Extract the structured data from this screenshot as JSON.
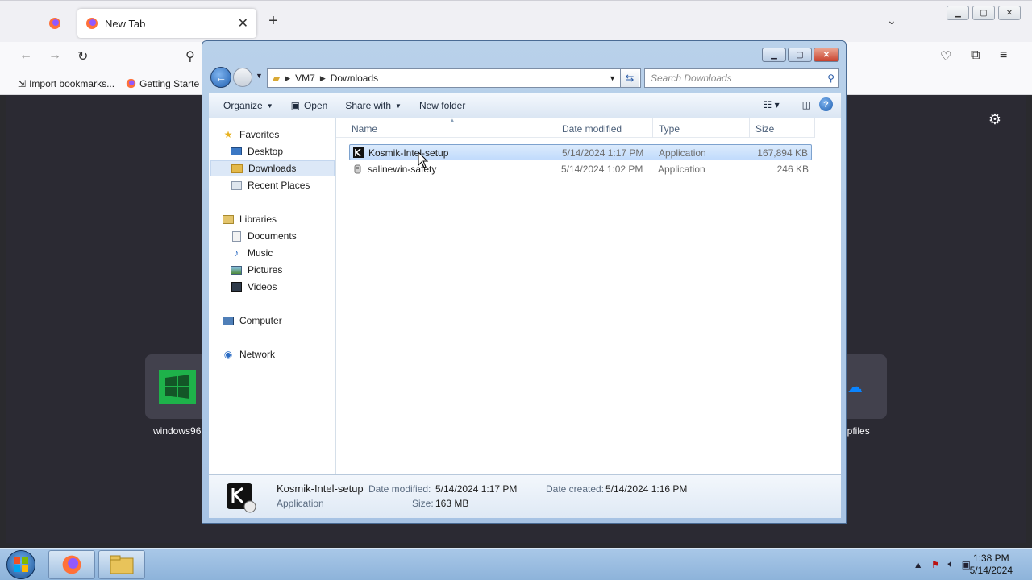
{
  "browser": {
    "tab_title": "New Tab",
    "bookmarks": [
      {
        "label": "Import bookmarks..."
      },
      {
        "label": "Getting Starte"
      }
    ],
    "tiles": [
      {
        "label": "windows96"
      },
      {
        "label": "npfiles"
      }
    ]
  },
  "explorer": {
    "breadcrumb": [
      "VM7",
      "Downloads"
    ],
    "search_placeholder": "Search Downloads",
    "toolbar": {
      "organize": "Organize",
      "open": "Open",
      "share_with": "Share with",
      "new_folder": "New folder"
    },
    "nav": {
      "favorites": "Favorites",
      "desktop": "Desktop",
      "downloads": "Downloads",
      "recent_places": "Recent Places",
      "libraries": "Libraries",
      "documents": "Documents",
      "music": "Music",
      "pictures": "Pictures",
      "videos": "Videos",
      "computer": "Computer",
      "network": "Network"
    },
    "columns": {
      "name": "Name",
      "date_modified": "Date modified",
      "type": "Type",
      "size": "Size"
    },
    "files": [
      {
        "name": "Kosmik-Intel-setup",
        "date": "5/14/2024 1:17 PM",
        "type": "Application",
        "size": "167,894 KB",
        "selected": true
      },
      {
        "name": "salinewin-safety",
        "date": "5/14/2024 1:02 PM",
        "type": "Application",
        "size": "246 KB",
        "selected": false
      }
    ],
    "details": {
      "name": "Kosmik-Intel-setup",
      "kind": "Application",
      "date_modified_label": "Date modified:",
      "date_modified": "5/14/2024 1:17 PM",
      "date_created_label": "Date created:",
      "date_created": "5/14/2024 1:16 PM",
      "size_label": "Size:",
      "size": "163 MB"
    }
  },
  "taskbar": {
    "time": "1:38 PM",
    "date": "5/14/2024"
  },
  "colors": {
    "selection": "#c1dbfc",
    "firefox_dark": "#2b2a33",
    "aero_blue": "#a7c3e4"
  }
}
